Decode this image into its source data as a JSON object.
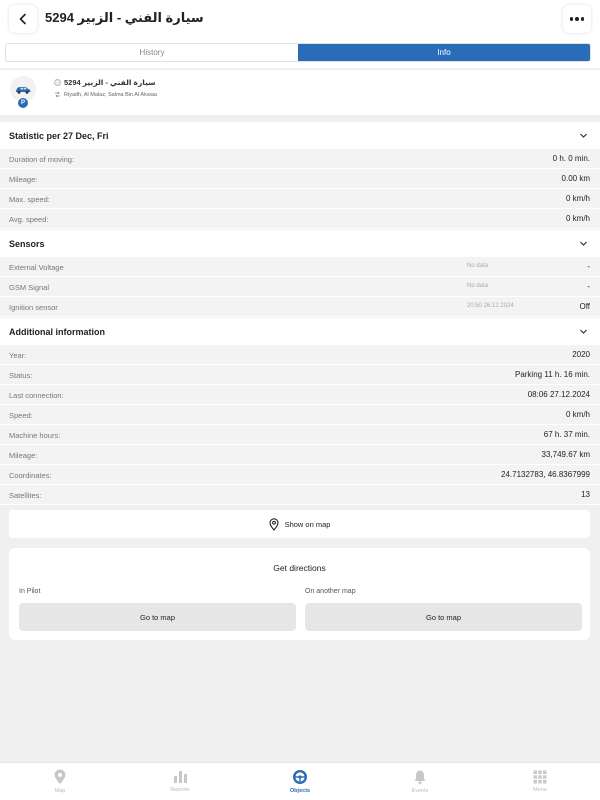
{
  "header": {
    "title": "سيارة الفني - الزبير 5294"
  },
  "tabs": [
    {
      "label": "History",
      "active": false
    },
    {
      "label": "Info",
      "active": true
    }
  ],
  "object": {
    "name": "سيارة الفني - الزبير 5294",
    "address": "Riyadh, Al Malaz, Salma Bin Al Akwaa",
    "badge": "P"
  },
  "statistic": {
    "title": "Statistic per 27 Dec, Fri",
    "rows": [
      {
        "label": "Duration of moving:",
        "value": "0 h. 0 min."
      },
      {
        "label": "Mileage:",
        "value": "0.00 km"
      },
      {
        "label": "Max. speed:",
        "value": "0 km/h"
      },
      {
        "label": "Avg. speed:",
        "value": "0 km/h"
      }
    ]
  },
  "sensors": {
    "title": "Sensors",
    "rows": [
      {
        "label": "External Voltage",
        "meta": "No data",
        "value": "-"
      },
      {
        "label": "GSM Signal",
        "meta": "No data",
        "value": "-"
      },
      {
        "label": "Ignition sensor",
        "meta": "20:50 26.12.2024",
        "value": "Off"
      }
    ]
  },
  "additional": {
    "title": "Additional information",
    "rows": [
      {
        "label": "Year:",
        "value": "2020"
      },
      {
        "label": "Status:",
        "value": "Parking 11 h. 16 min."
      },
      {
        "label": "Last connection:",
        "value": "08:06 27.12.2024"
      },
      {
        "label": "Speed:",
        "value": "0 km/h"
      },
      {
        "label": "Machine hours:",
        "value": "67 h. 37 min."
      },
      {
        "label": "Mileage:",
        "value": "33,749.67 km"
      },
      {
        "label": "Coordinates:",
        "value": "24.7132783, 46.8367999"
      },
      {
        "label": "Satellites:",
        "value": "13"
      }
    ]
  },
  "show_map": {
    "label": "Show on map"
  },
  "directions": {
    "title": "Get directions",
    "left_label": "In Pilot",
    "right_label": "On another map",
    "button_label": "Go to map"
  },
  "nav": [
    {
      "label": "Map",
      "icon": "map-pin-icon",
      "active": false
    },
    {
      "label": "Reports",
      "icon": "bar-chart-icon",
      "active": false
    },
    {
      "label": "Objects",
      "icon": "steering-wheel-icon",
      "active": true
    },
    {
      "label": "Events",
      "icon": "bell-icon",
      "active": false
    },
    {
      "label": "Menu",
      "icon": "grid-icon",
      "active": false
    }
  ],
  "colors": {
    "accent": "#2b6cb8",
    "row_bg": "#f3f3f3",
    "page_bg": "#f0f0f0"
  }
}
